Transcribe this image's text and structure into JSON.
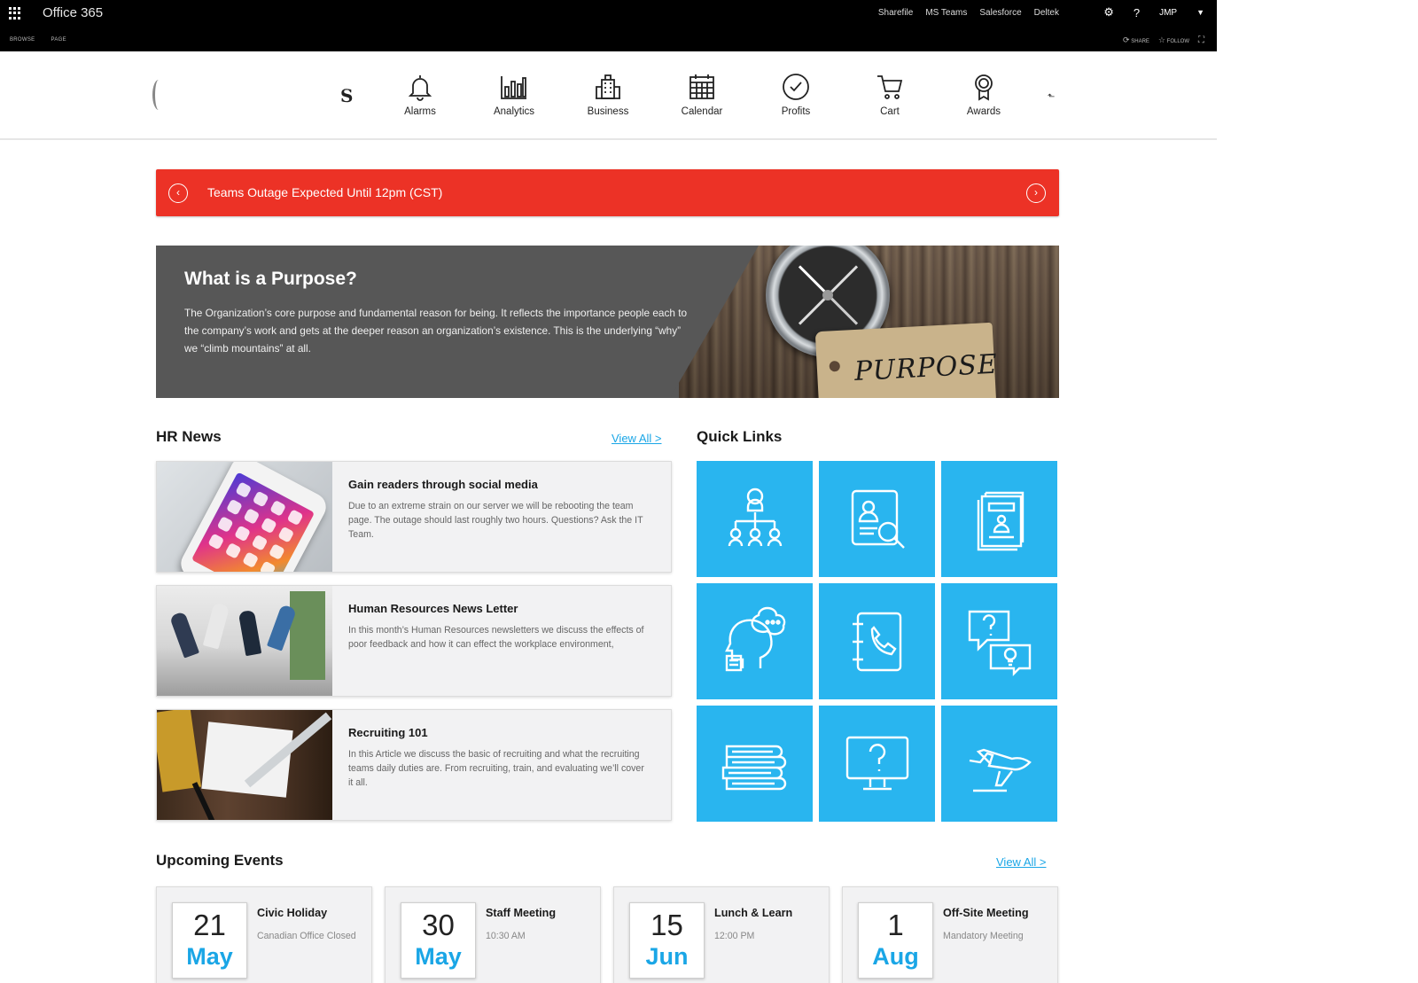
{
  "suite": {
    "app_title": "Office 365",
    "links": [
      "Sharefile",
      "MS Teams",
      "Salesforce",
      "Deltek"
    ],
    "user": "JMP",
    "row2_left": [
      "BROWSE",
      "PAGE"
    ],
    "share": "SHARE",
    "follow": "FOLLOW"
  },
  "nav": {
    "logo_letter": "S",
    "items": [
      {
        "label": "Alarms",
        "icon": "bell-icon"
      },
      {
        "label": "Analytics",
        "icon": "bar-chart-icon"
      },
      {
        "label": "Business",
        "icon": "building-icon"
      },
      {
        "label": "Calendar",
        "icon": "calendar-icon"
      },
      {
        "label": "Profits",
        "icon": "check-circle-icon"
      },
      {
        "label": "Cart",
        "icon": "cart-icon"
      },
      {
        "label": "Awards",
        "icon": "award-icon"
      }
    ]
  },
  "alert": {
    "text": "Teams Outage Expected Until 12pm (CST)",
    "color": "#ec3226"
  },
  "hero": {
    "title": "What is a Purpose?",
    "body": "The Organization’s core purpose and fundamental reason for being. It reflects the importance people each to the company’s work and gets at the deeper reason an organization’s existence. This is the underlying “why” we “climb mountains” at all.",
    "tag_word": "PURPOSE"
  },
  "hr_news": {
    "title": "HR News",
    "view_all": "View All >",
    "items": [
      {
        "title": "Gain readers through social media",
        "desc": "Due to an extreme strain on our server we will be rebooting the team page. The outage should last roughly two hours. Questions? Ask the IT Team."
      },
      {
        "title": "Human Resources News Letter",
        "desc": "In this month’s Human Resources newsletters we discuss the effects of poor feedback and how it can effect the workplace environment,"
      },
      {
        "title": "Recruiting 101",
        "desc": "In this Article we discuss the basic of recruiting and what the recruiting teams daily duties are. From recruiting, train, and evaluating we’ll cover it all."
      }
    ]
  },
  "quick_links": {
    "title": "Quick Links",
    "color": "#29b5ef",
    "items": [
      {
        "icon": "org-chart-icon"
      },
      {
        "icon": "profile-search-icon"
      },
      {
        "icon": "documents-icon"
      },
      {
        "icon": "thinking-head-icon"
      },
      {
        "icon": "phonebook-icon"
      },
      {
        "icon": "question-idea-icon"
      },
      {
        "icon": "books-icon"
      },
      {
        "icon": "help-monitor-icon"
      },
      {
        "icon": "airplane-icon"
      }
    ]
  },
  "events": {
    "title": "Upcoming Events",
    "view_all": "View All >",
    "items": [
      {
        "day": "21",
        "month": "May",
        "title": "Civic Holiday",
        "sub": "Canadian Office Closed"
      },
      {
        "day": "30",
        "month": "May",
        "title": "Staff Meeting",
        "sub": "10:30 AM"
      },
      {
        "day": "15",
        "month": "Jun",
        "title": "Lunch & Learn",
        "sub": "12:00 PM"
      },
      {
        "day": "1",
        "month": "Aug",
        "title": "Off-Site Meeting",
        "sub": "Mandatory Meeting"
      }
    ]
  }
}
